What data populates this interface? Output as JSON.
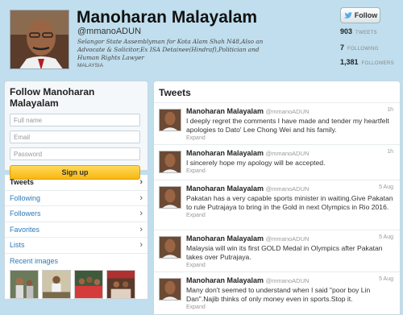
{
  "profile": {
    "name": "Manoharan Malayalam",
    "handle": "@mmanoADUN",
    "bio": "Selangor State Assemblyman for Kota Alam Shah N48,Also an Advocate & Solicitor,Ex ISA Detainee(Hindraf),Politician and Human Rights Lawyer",
    "location": "MALAYSIA",
    "follow_label": "Follow",
    "stats": {
      "tweets_count": "903",
      "tweets_label": "TWEETS",
      "following_count": "7",
      "following_label": "FOLLOWING",
      "followers_count": "1,381",
      "followers_label": "FOLLOWERS"
    }
  },
  "follow_box": {
    "title": "Follow Manoharan Malayalam",
    "fullname_placeholder": "Full name",
    "email_placeholder": "Email",
    "password_placeholder": "Password",
    "signup_label": "Sign up"
  },
  "nav": {
    "items": [
      {
        "label": "Tweets",
        "active": true
      },
      {
        "label": "Following"
      },
      {
        "label": "Followers"
      },
      {
        "label": "Favorites"
      },
      {
        "label": "Lists"
      }
    ],
    "recent_images_label": "Recent images"
  },
  "tweets": {
    "title": "Tweets",
    "items": [
      {
        "name": "Manoharan Malayalam",
        "handle": "@mmanoADUN",
        "time": "1h",
        "text": "I deeply regret the comments I have made and tender my heartfelt apologies to Dato' Lee Chong Wei and his family.",
        "expand": "Expand"
      },
      {
        "name": "Manoharan Malayalam",
        "handle": "@mmanoADUN",
        "time": "1h",
        "text": "I sincerely hope my apology will be accepted.",
        "expand": "Expand"
      },
      {
        "name": "Manoharan Malayalam",
        "handle": "@mmanoADUN",
        "time": "5 Aug",
        "text": "Pakatan has a very capable sports minister in waiting.Give Pakatan to rule Putrajaya to bring in the Gold in next Olympics in Rio 2016.",
        "expand": "Expand"
      },
      {
        "name": "Manoharan Malayalam",
        "handle": "@mmanoADUN",
        "time": "5 Aug",
        "text": "Malaysia will win its first GOLD Medal in Olympics after Pakatan takes over Putrajaya.",
        "expand": "Expand"
      },
      {
        "name": "Manoharan Malayalam",
        "handle": "@mmanoADUN",
        "time": "5 Aug",
        "text": "Many don't seemed to understand when I said \"poor boy Lin Dan\".Najib thinks of only money even in sports.Stop it.",
        "expand": "Expand"
      }
    ]
  },
  "colors": {
    "background": "#c0deed",
    "link": "#2b7bb9",
    "signup": "#f8b712"
  }
}
